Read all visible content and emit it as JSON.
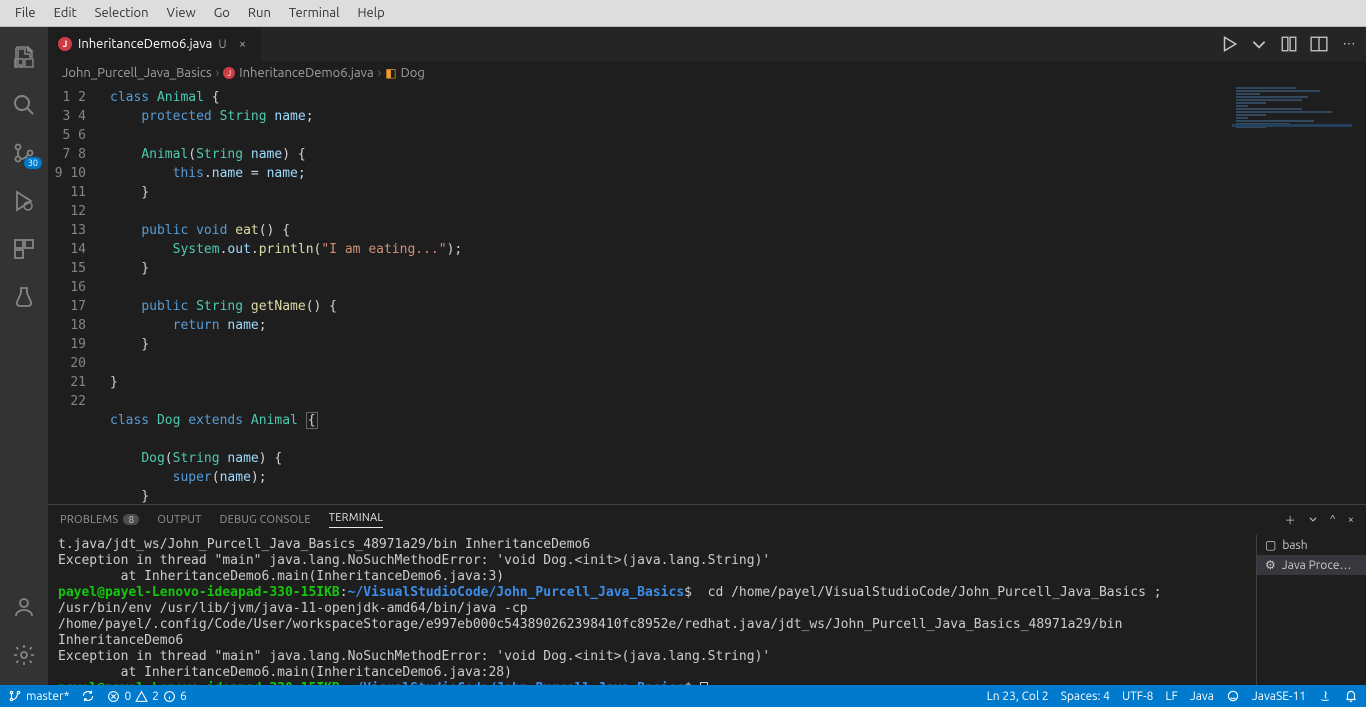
{
  "menubar": [
    "File",
    "Edit",
    "Selection",
    "View",
    "Go",
    "Run",
    "Terminal",
    "Help"
  ],
  "tab": {
    "icon_letter": "J",
    "filename": "InheritanceDemo6.java",
    "mod_badge": "U"
  },
  "breadcrumbs": {
    "folder": "John_Purcell_Java_Basics",
    "file": "InheritanceDemo6.java",
    "symbol": "Dog"
  },
  "activity": {
    "scm_badge": "30"
  },
  "code_lines": 22,
  "code": {
    "l1": [
      "class ",
      "Animal",
      " {"
    ],
    "l2": [
      "    ",
      "protected ",
      "String ",
      "name",
      ";"
    ],
    "l3": "",
    "l4": [
      "    ",
      "Animal",
      "(",
      "String ",
      "name",
      ") {"
    ],
    "l5": [
      "        ",
      "this",
      ".",
      "name",
      " = ",
      "name",
      ";"
    ],
    "l6": "    }",
    "l7": "",
    "l8": [
      "    ",
      "public ",
      "void ",
      "eat",
      "() {"
    ],
    "l9": [
      "        ",
      "System",
      ".",
      "out",
      ".",
      "println",
      "(",
      "\"I am eating...\"",
      ");"
    ],
    "l10": "    }",
    "l11": "",
    "l12": [
      "    ",
      "public ",
      "String ",
      "getName",
      "() {"
    ],
    "l13": [
      "        ",
      "return ",
      "name",
      ";"
    ],
    "l14": "    }",
    "l15": "",
    "l16": "}",
    "l17": "",
    "l18": [
      "class ",
      "Dog",
      " ",
      "extends ",
      "Animal",
      " ",
      "{"
    ],
    "l19": "",
    "l20": [
      "    ",
      "Dog",
      "(",
      "String ",
      "name",
      ") {"
    ],
    "l21": [
      "        ",
      "super",
      "(",
      "name",
      ");"
    ],
    "l22": "    }"
  },
  "panel": {
    "tabs": {
      "problems": "PROBLEMS",
      "problems_count": "8",
      "output": "OUTPUT",
      "debug": "DEBUG CONSOLE",
      "terminal": "TERMINAL"
    },
    "side": {
      "bash": "bash",
      "java": "Java Proce…"
    }
  },
  "terminal": {
    "l1": "t.java/jdt_ws/John_Purcell_Java_Basics_48971a29/bin InheritanceDemo6",
    "l2": "Exception in thread \"main\" java.lang.NoSuchMethodError: 'void Dog.<init>(java.lang.String)'",
    "l3": "        at InheritanceDemo6.main(InheritanceDemo6.java:3)",
    "user": "payel@payel-Lenovo-ideapad-330-15IKB",
    "path": "~/VisualStudioCode/John_Purcell_Java_Basics",
    "cmd": "cd /home/payel/VisualStudioCode/John_Purcell_Java_Basics ; /usr/bin/env /usr/lib/jvm/java-11-openjdk-amd64/bin/java -cp /home/payel/.config/Code/User/workspaceStorage/e997eb000c543890262398410fc8952e/redhat.java/jdt_ws/John_Purcell_Java_Basics_48971a29/bin InheritanceDemo6",
    "l4": "Exception in thread \"main\" java.lang.NoSuchMethodError: 'void Dog.<init>(java.lang.String)'",
    "l5": "        at InheritanceDemo6.main(InheritanceDemo6.java:28)"
  },
  "status": {
    "branch": "master*",
    "sync": "",
    "errors": "0",
    "warnings": "2",
    "info": "6",
    "cursor": "Ln 23, Col 2",
    "spaces": "Spaces: 4",
    "encoding": "UTF-8",
    "eol": "LF",
    "lang": "Java",
    "jdk": "JavaSE-11"
  }
}
